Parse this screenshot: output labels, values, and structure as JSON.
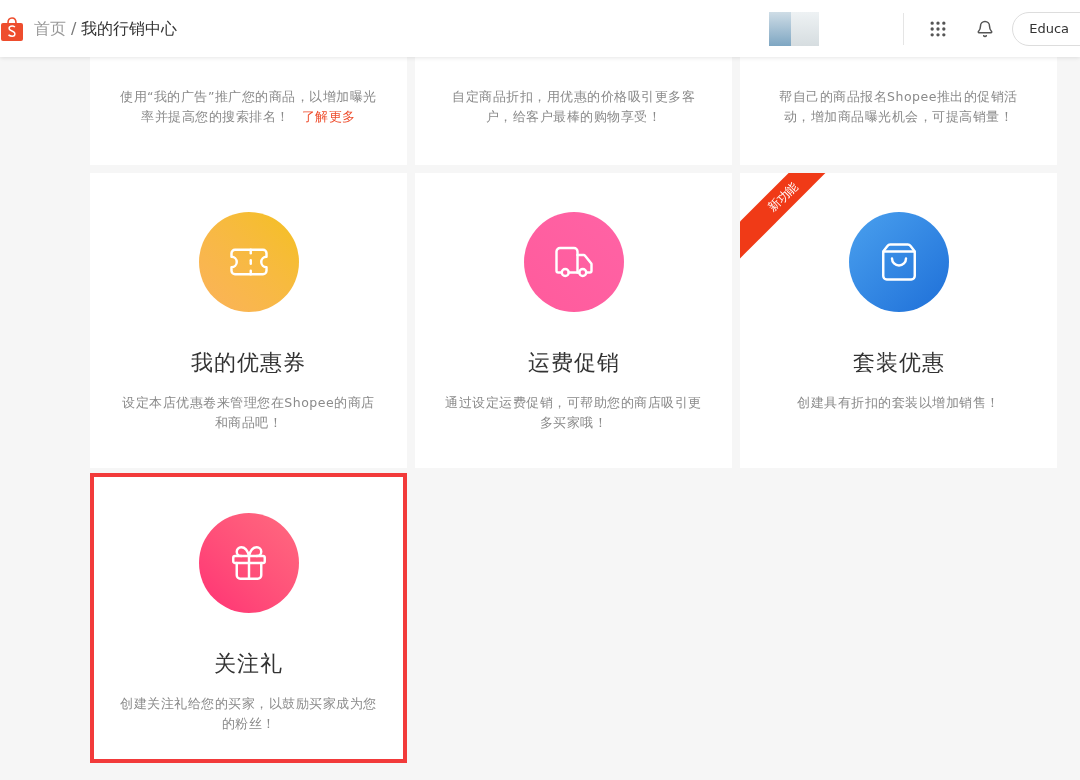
{
  "header": {
    "breadcrumb": [
      {
        "label": "首页"
      },
      {
        "label": "我的行销中心"
      }
    ],
    "separator": "/",
    "account_button": "Educa"
  },
  "cards": [
    {
      "kind": "partial",
      "description": "使用“我的广告”推广您的商品，以增加曝光率并提高您的搜索排名！",
      "link": "了解更多"
    },
    {
      "kind": "partial",
      "description": "自定商品折扣，用优惠的价格吸引更多客户，给客户最棒的购物享受！"
    },
    {
      "kind": "partial",
      "description": "帮自己的商品报名Shopee推出的促销活动，增加商品曝光机会，可提高销量！"
    },
    {
      "kind": "full",
      "title": "我的优惠券",
      "description": "设定本店优惠卷来管理您在Shopee的商店和商品吧！",
      "highlighted": false
    },
    {
      "kind": "full",
      "title": "运费促销",
      "description": "通过设定运费促销，可帮助您的商店吸引更多买家哦！",
      "highlighted": false
    },
    {
      "kind": "full",
      "title": "套装优惠",
      "description": "创建具有折扣的套装以增加销售！",
      "badge": "新功能",
      "highlighted": false
    },
    {
      "kind": "full",
      "title": "关注礼",
      "description": "创建关注礼给您的买家，以鼓励买家成为您的粉丝！",
      "highlighted": true
    }
  ]
}
